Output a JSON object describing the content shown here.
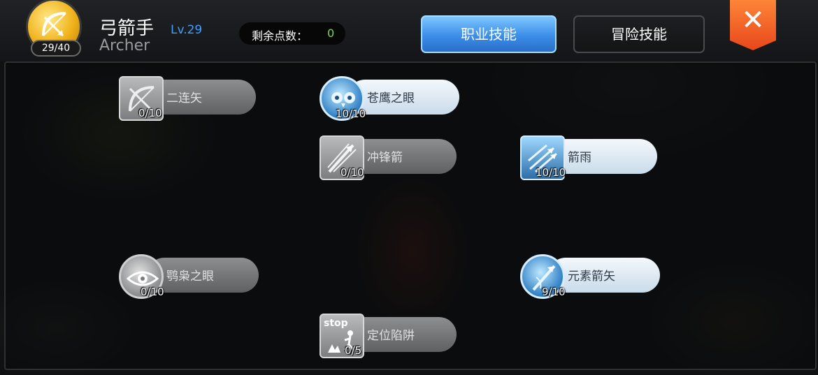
{
  "header": {
    "avatar_level": "29/40",
    "class_name_cn": "弓箭手",
    "class_level": "Lv.29",
    "class_name_en": "Archer",
    "points_label": "剩余点数：",
    "points_value": "0",
    "tabs": [
      {
        "label": "职业技能",
        "active": true
      },
      {
        "label": "冒险技能",
        "active": false
      }
    ],
    "close_label": "✕"
  },
  "skills": [
    {
      "name": "二连矢",
      "count": "0/10",
      "state": "locked",
      "icon": "bow-icon"
    },
    {
      "name": "苍鹰之眼",
      "count": "10/10",
      "state": "active",
      "icon": "owl-icon"
    },
    {
      "name": "冲锋箭",
      "count": "0/10",
      "state": "locked",
      "icon": "charge-arrow-icon"
    },
    {
      "name": "箭雨",
      "count": "10/10",
      "state": "active",
      "icon": "arrow-rain-icon"
    },
    {
      "name": "鹗枭之眼",
      "count": "0/10",
      "state": "locked",
      "icon": "eye-icon"
    },
    {
      "name": "元素箭矢",
      "count": "9/10",
      "state": "active",
      "icon": "element-arrow-icon"
    },
    {
      "name": "定位陷阱",
      "count": "0/5",
      "state": "locked",
      "icon": "stop-trap-icon",
      "icon_text": "stop"
    }
  ],
  "colors": {
    "accent_blue": "#3b8ee8",
    "close_orange": "#e8471b",
    "points_green": "#7fd64c",
    "level_blue": "#3fa0ff"
  }
}
